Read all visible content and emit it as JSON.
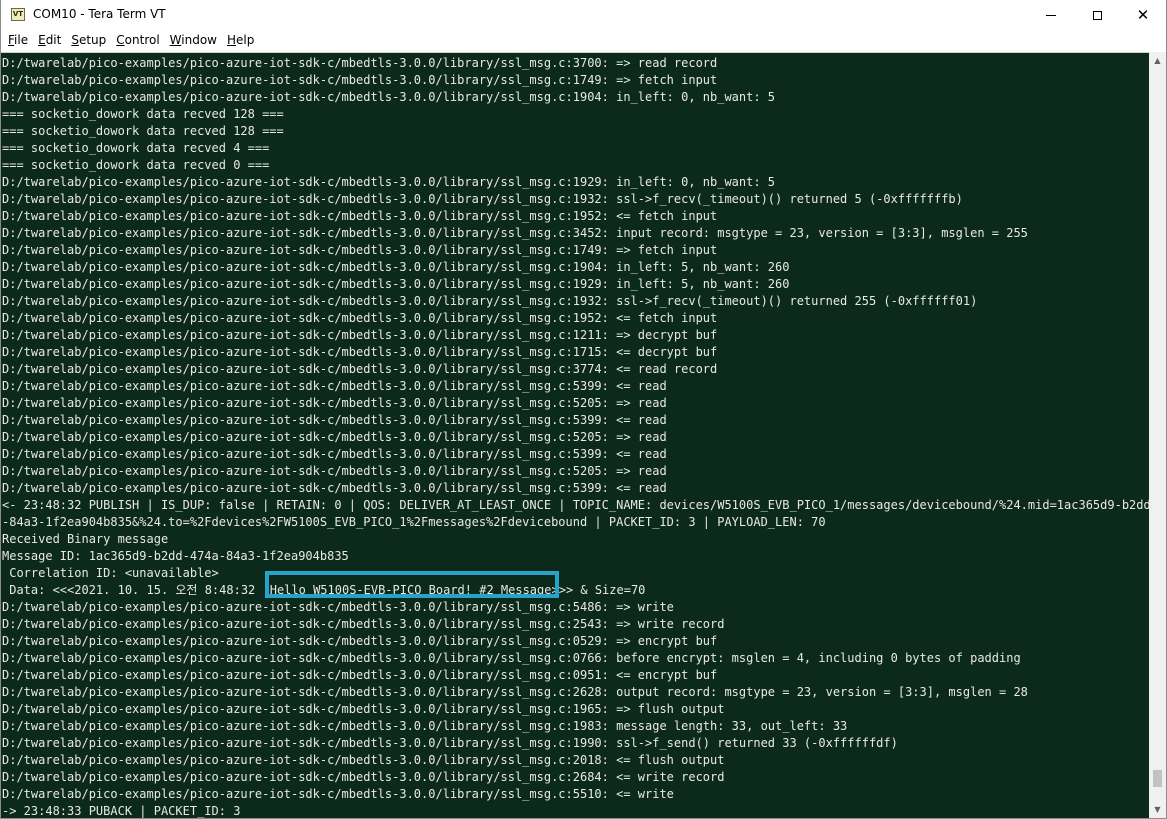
{
  "window": {
    "title": "COM10 - Tera Term VT",
    "icon_label": "VT",
    "controls": {
      "minimize": "minimize-icon",
      "maximize": "maximize-icon",
      "close": "close-icon",
      "close_glyph": "✕"
    }
  },
  "menu": {
    "items": [
      {
        "hotkey": "F",
        "rest": "ile"
      },
      {
        "hotkey": "E",
        "rest": "dit"
      },
      {
        "hotkey": "S",
        "rest": "etup"
      },
      {
        "hotkey": "C",
        "rest": "ontrol"
      },
      {
        "hotkey": "W",
        "rest": "indow"
      },
      {
        "hotkey": "H",
        "rest": "elp"
      }
    ]
  },
  "terminal": {
    "colors": {
      "background": "#0c2a1b",
      "text": "#e8e8e8",
      "highlight_border": "#27a3c9"
    },
    "lines": [
      "D:/twarelab/pico-examples/pico-azure-iot-sdk-c/mbedtls-3.0.0/library/ssl_msg.c:3700: => read record",
      "D:/twarelab/pico-examples/pico-azure-iot-sdk-c/mbedtls-3.0.0/library/ssl_msg.c:1749: => fetch input",
      "D:/twarelab/pico-examples/pico-azure-iot-sdk-c/mbedtls-3.0.0/library/ssl_msg.c:1904: in_left: 0, nb_want: 5",
      "=== socketio_dowork data recved 128 ===",
      "=== socketio_dowork data recved 128 ===",
      "=== socketio_dowork data recved 4 ===",
      "=== socketio_dowork data recved 0 ===",
      "D:/twarelab/pico-examples/pico-azure-iot-sdk-c/mbedtls-3.0.0/library/ssl_msg.c:1929: in_left: 0, nb_want: 5",
      "D:/twarelab/pico-examples/pico-azure-iot-sdk-c/mbedtls-3.0.0/library/ssl_msg.c:1932: ssl->f_recv(_timeout)() returned 5 (-0xfffffffb)",
      "D:/twarelab/pico-examples/pico-azure-iot-sdk-c/mbedtls-3.0.0/library/ssl_msg.c:1952: <= fetch input",
      "D:/twarelab/pico-examples/pico-azure-iot-sdk-c/mbedtls-3.0.0/library/ssl_msg.c:3452: input record: msgtype = 23, version = [3:3], msglen = 255",
      "D:/twarelab/pico-examples/pico-azure-iot-sdk-c/mbedtls-3.0.0/library/ssl_msg.c:1749: => fetch input",
      "D:/twarelab/pico-examples/pico-azure-iot-sdk-c/mbedtls-3.0.0/library/ssl_msg.c:1904: in_left: 5, nb_want: 260",
      "D:/twarelab/pico-examples/pico-azure-iot-sdk-c/mbedtls-3.0.0/library/ssl_msg.c:1929: in_left: 5, nb_want: 260",
      "D:/twarelab/pico-examples/pico-azure-iot-sdk-c/mbedtls-3.0.0/library/ssl_msg.c:1932: ssl->f_recv(_timeout)() returned 255 (-0xffffff01)",
      "D:/twarelab/pico-examples/pico-azure-iot-sdk-c/mbedtls-3.0.0/library/ssl_msg.c:1952: <= fetch input",
      "D:/twarelab/pico-examples/pico-azure-iot-sdk-c/mbedtls-3.0.0/library/ssl_msg.c:1211: => decrypt buf",
      "D:/twarelab/pico-examples/pico-azure-iot-sdk-c/mbedtls-3.0.0/library/ssl_msg.c:1715: <= decrypt buf",
      "D:/twarelab/pico-examples/pico-azure-iot-sdk-c/mbedtls-3.0.0/library/ssl_msg.c:3774: <= read record",
      "D:/twarelab/pico-examples/pico-azure-iot-sdk-c/mbedtls-3.0.0/library/ssl_msg.c:5399: <= read",
      "D:/twarelab/pico-examples/pico-azure-iot-sdk-c/mbedtls-3.0.0/library/ssl_msg.c:5205: => read",
      "D:/twarelab/pico-examples/pico-azure-iot-sdk-c/mbedtls-3.0.0/library/ssl_msg.c:5399: <= read",
      "D:/twarelab/pico-examples/pico-azure-iot-sdk-c/mbedtls-3.0.0/library/ssl_msg.c:5205: => read",
      "D:/twarelab/pico-examples/pico-azure-iot-sdk-c/mbedtls-3.0.0/library/ssl_msg.c:5399: <= read",
      "D:/twarelab/pico-examples/pico-azure-iot-sdk-c/mbedtls-3.0.0/library/ssl_msg.c:5205: => read",
      "D:/twarelab/pico-examples/pico-azure-iot-sdk-c/mbedtls-3.0.0/library/ssl_msg.c:5399: <= read",
      "<- 23:48:32 PUBLISH | IS_DUP: false | RETAIN: 0 | QOS: DELIVER_AT_LEAST_ONCE | TOPIC_NAME: devices/W5100S_EVB_PICO_1/messages/devicebound/%24.mid=1ac365d9-b2dd-474a",
      "-84a3-1f2ea904b835&%24.to=%2Fdevices%2FW5100S_EVB_PICO_1%2Fmessages%2Fdevicebound | PACKET_ID: 3 | PAYLOAD_LEN: 70",
      "Received Binary message",
      "Message ID: 1ac365d9-b2dd-474a-84a3-1f2ea904b835",
      " Correlation ID: <unavailable>",
      " Data: <<<2021. 10. 15. 오전 8:48:32  Hello W5100S-EVB-PICO Board! #2 Message>>> & Size=70",
      "D:/twarelab/pico-examples/pico-azure-iot-sdk-c/mbedtls-3.0.0/library/ssl_msg.c:5486: => write",
      "D:/twarelab/pico-examples/pico-azure-iot-sdk-c/mbedtls-3.0.0/library/ssl_msg.c:2543: => write record",
      "D:/twarelab/pico-examples/pico-azure-iot-sdk-c/mbedtls-3.0.0/library/ssl_msg.c:0529: => encrypt buf",
      "D:/twarelab/pico-examples/pico-azure-iot-sdk-c/mbedtls-3.0.0/library/ssl_msg.c:0766: before encrypt: msglen = 4, including 0 bytes of padding",
      "D:/twarelab/pico-examples/pico-azure-iot-sdk-c/mbedtls-3.0.0/library/ssl_msg.c:0951: <= encrypt buf",
      "D:/twarelab/pico-examples/pico-azure-iot-sdk-c/mbedtls-3.0.0/library/ssl_msg.c:2628: output record: msgtype = 23, version = [3:3], msglen = 28",
      "D:/twarelab/pico-examples/pico-azure-iot-sdk-c/mbedtls-3.0.0/library/ssl_msg.c:1965: => flush output",
      "D:/twarelab/pico-examples/pico-azure-iot-sdk-c/mbedtls-3.0.0/library/ssl_msg.c:1983: message length: 33, out_left: 33",
      "D:/twarelab/pico-examples/pico-azure-iot-sdk-c/mbedtls-3.0.0/library/ssl_msg.c:1990: ssl->f_send() returned 33 (-0xffffffdf)",
      "D:/twarelab/pico-examples/pico-azure-iot-sdk-c/mbedtls-3.0.0/library/ssl_msg.c:2018: <= flush output",
      "D:/twarelab/pico-examples/pico-azure-iot-sdk-c/mbedtls-3.0.0/library/ssl_msg.c:2684: <= write record",
      "D:/twarelab/pico-examples/pico-azure-iot-sdk-c/mbedtls-3.0.0/library/ssl_msg.c:5510: <= write",
      "-> 23:48:33 PUBACK | PACKET_ID: 3"
    ]
  },
  "scrollbar": {
    "up_arrow": "▲",
    "down_arrow": "▼",
    "position_fraction": 0.98
  }
}
